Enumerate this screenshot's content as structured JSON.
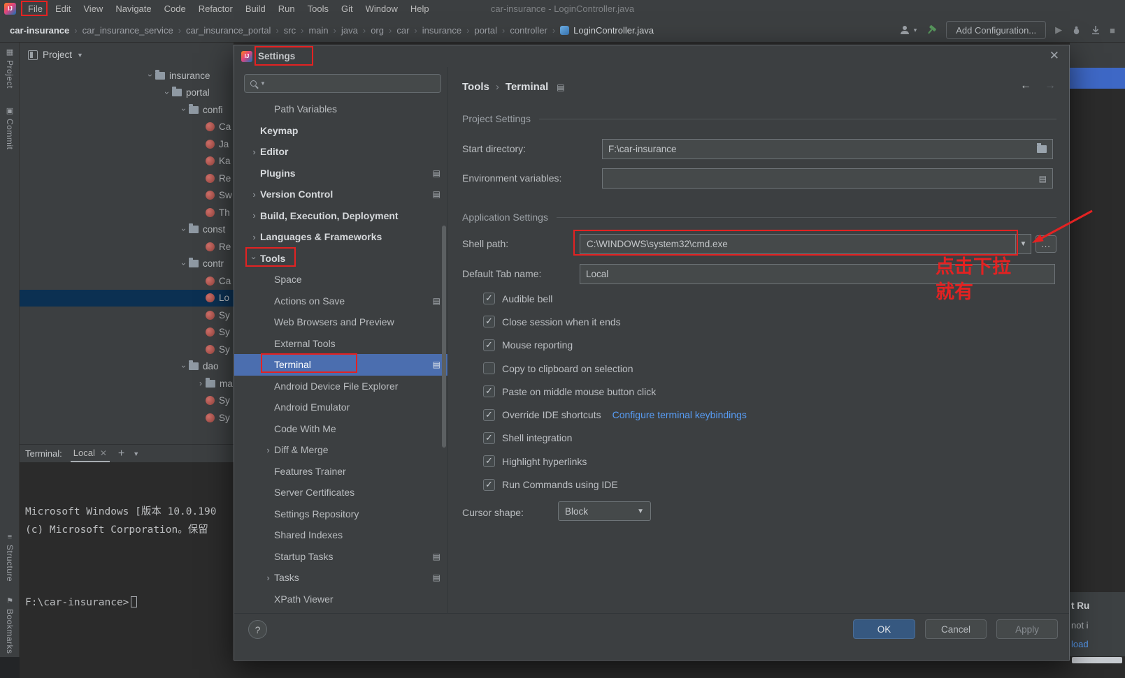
{
  "colors": {
    "annotation_red": "#e32222",
    "nav_selection_blue": "#4b6eaf",
    "link_blue": "#589df6",
    "ok_button_blue": "#365880",
    "editor_tab_blue": "#3e68c6",
    "panel_bg": "#3c3f41",
    "editor_bg": "#2b2b2b"
  },
  "menu_bar": {
    "items": [
      "File",
      "Edit",
      "View",
      "Navigate",
      "Code",
      "Refactor",
      "Build",
      "Run",
      "Tools",
      "Git",
      "Window",
      "Help"
    ],
    "window_title": "car-insurance - LoginController.java"
  },
  "toolbar": {
    "breadcrumbs": [
      "car-insurance",
      "car_insurance_service",
      "car_insurance_portal",
      "src",
      "main",
      "java",
      "org",
      "car",
      "insurance",
      "portal",
      "controller",
      "LoginController.java"
    ],
    "add_configuration_label": "Add Configuration..."
  },
  "tool_stripe": {
    "top_items": [
      {
        "label": "Project",
        "icon": "▦"
      },
      {
        "label": "Commit",
        "icon": "▣"
      }
    ],
    "bottom_items": [
      {
        "label": "Structure",
        "icon": "≡"
      },
      {
        "label": "Bookmarks",
        "icon": "⚑"
      }
    ]
  },
  "project_panel": {
    "title": "Project",
    "tree": [
      {
        "label": "insurance",
        "chev": "›",
        "flags": "folder open tind0"
      },
      {
        "label": "portal",
        "chev": "›",
        "flags": "folder open tind1"
      },
      {
        "label": "confi",
        "chev": "›",
        "flags": "folder open tind2"
      },
      {
        "label": "Ca",
        "chev": "",
        "flags": "cls tind3"
      },
      {
        "label": "Ja",
        "chev": "",
        "flags": "cls tind3"
      },
      {
        "label": "Ka",
        "chev": "",
        "flags": "cls tind3"
      },
      {
        "label": "Re",
        "chev": "",
        "flags": "cls tind3"
      },
      {
        "label": "Sw",
        "chev": "",
        "flags": "cls tind3"
      },
      {
        "label": "Th",
        "chev": "",
        "flags": "cls tind3"
      },
      {
        "label": "const",
        "chev": "›",
        "flags": "folder open tind2"
      },
      {
        "label": "Re",
        "chev": "",
        "flags": "cls tind3"
      },
      {
        "label": "contr",
        "chev": "›",
        "flags": "folder open tind2"
      },
      {
        "label": "Ca",
        "chev": "",
        "flags": "cls tind3"
      },
      {
        "label": "Lo",
        "chev": "",
        "flags": "cls tind3 sel"
      },
      {
        "label": "Sy",
        "chev": "",
        "flags": "cls tind3"
      },
      {
        "label": "Sy",
        "chev": "",
        "flags": "cls tind3"
      },
      {
        "label": "Sy",
        "chev": "",
        "flags": "cls tind3"
      },
      {
        "label": "dao",
        "chev": "›",
        "flags": "folder open tind2"
      },
      {
        "label": "ma",
        "chev": "›",
        "flags": "folder tind3"
      },
      {
        "label": "Sy",
        "chev": "",
        "flags": "cls tind3"
      },
      {
        "label": "Sy",
        "chev": "",
        "flags": "cls tind3"
      }
    ]
  },
  "terminal_panel": {
    "label": "Terminal:",
    "tab_label": "Local",
    "lines": [
      "Microsoft Windows [版本 10.0.190",
      "(c) Microsoft Corporation。保留",
      ""
    ],
    "prompt": "F:\\car-insurance>"
  },
  "settings_dialog": {
    "title": "Settings",
    "search_placeholder": "",
    "nav": [
      {
        "label": "Path Variables",
        "chev": "",
        "ricon": "",
        "flags": "ind1"
      },
      {
        "label": "Keymap",
        "chev": "",
        "ricon": "",
        "flags": "ind0 b"
      },
      {
        "label": "Editor",
        "chev": "›",
        "ricon": "",
        "flags": "ind0 b"
      },
      {
        "label": "Plugins",
        "chev": "",
        "ricon": "▤",
        "flags": "ind0 b"
      },
      {
        "label": "Version Control",
        "chev": "›",
        "ricon": "▤",
        "flags": "ind0 b"
      },
      {
        "label": "Build, Execution, Deployment",
        "chev": "›",
        "ricon": "",
        "flags": "ind0 b"
      },
      {
        "label": "Languages & Frameworks",
        "chev": "›",
        "ricon": "",
        "flags": "ind0 b"
      },
      {
        "label": "Tools",
        "chev": "›",
        "ricon": "",
        "flags": "ind0 b open"
      },
      {
        "label": "Space",
        "chev": "",
        "ricon": "",
        "flags": "ind1"
      },
      {
        "label": "Actions on Save",
        "chev": "",
        "ricon": "▤",
        "flags": "ind1"
      },
      {
        "label": "Web Browsers and Preview",
        "chev": "",
        "ricon": "",
        "flags": "ind1"
      },
      {
        "label": "External Tools",
        "chev": "",
        "ricon": "",
        "flags": "ind1"
      },
      {
        "label": "Terminal",
        "chev": "",
        "ricon": "▤",
        "flags": "ind1 sel"
      },
      {
        "label": "Android Device File Explorer",
        "chev": "",
        "ricon": "",
        "flags": "ind1"
      },
      {
        "label": "Android Emulator",
        "chev": "",
        "ricon": "",
        "flags": "ind1"
      },
      {
        "label": "Code With Me",
        "chev": "",
        "ricon": "",
        "flags": "ind1"
      },
      {
        "label": "Diff & Merge",
        "chev": "›",
        "ricon": "",
        "flags": "ind1"
      },
      {
        "label": "Features Trainer",
        "chev": "",
        "ricon": "",
        "flags": "ind1"
      },
      {
        "label": "Server Certificates",
        "chev": "",
        "ricon": "",
        "flags": "ind1"
      },
      {
        "label": "Settings Repository",
        "chev": "",
        "ricon": "",
        "flags": "ind1"
      },
      {
        "label": "Shared Indexes",
        "chev": "",
        "ricon": "",
        "flags": "ind1"
      },
      {
        "label": "Startup Tasks",
        "chev": "",
        "ricon": "▤",
        "flags": "ind1"
      },
      {
        "label": "Tasks",
        "chev": "›",
        "ricon": "▤",
        "flags": "ind1"
      },
      {
        "label": "XPath Viewer",
        "chev": "",
        "ricon": "",
        "flags": "ind1"
      }
    ],
    "content": {
      "breadcrumb": [
        "Tools",
        "Terminal"
      ],
      "project_settings_header": "Project Settings",
      "start_directory_label": "Start directory:",
      "start_directory_value": "F:\\car-insurance",
      "environment_variables_label": "Environment variables:",
      "environment_variables_value": "",
      "application_settings_header": "Application Settings",
      "shell_path_label": "Shell path:",
      "shell_path_value": "C:\\WINDOWS\\system32\\cmd.exe",
      "browse_label": "...",
      "default_tab_name_label": "Default Tab name:",
      "default_tab_name_value": "Local",
      "checkboxes": [
        {
          "label": "Audible bell",
          "link": "",
          "flags": "checked"
        },
        {
          "label": "Close session when it ends",
          "link": "",
          "flags": "checked"
        },
        {
          "label": "Mouse reporting",
          "link": "",
          "flags": "checked"
        },
        {
          "label": "Copy to clipboard on selection",
          "link": "",
          "flags": ""
        },
        {
          "label": "Paste on middle mouse button click",
          "link": "",
          "flags": "checked"
        },
        {
          "label": "Override IDE shortcuts",
          "link": "Configure terminal keybindings",
          "flags": "checked"
        },
        {
          "label": "Shell integration",
          "link": "",
          "flags": "checked"
        },
        {
          "label": "Highlight hyperlinks",
          "link": "",
          "flags": "checked"
        },
        {
          "label": "Run Commands using IDE",
          "link": "",
          "flags": "checked"
        }
      ],
      "cursor_shape_label": "Cursor shape:",
      "cursor_shape_value": "Block"
    },
    "footer": {
      "help": "?",
      "ok": "OK",
      "cancel": "Cancel",
      "apply": "Apply"
    }
  },
  "annotations": {
    "note_line1": "点击下拉",
    "note_line2": "就有"
  },
  "right_edge_fragments": {
    "notification_line1": "t Ru",
    "notification_line2": "not i",
    "notification_link": "load"
  }
}
